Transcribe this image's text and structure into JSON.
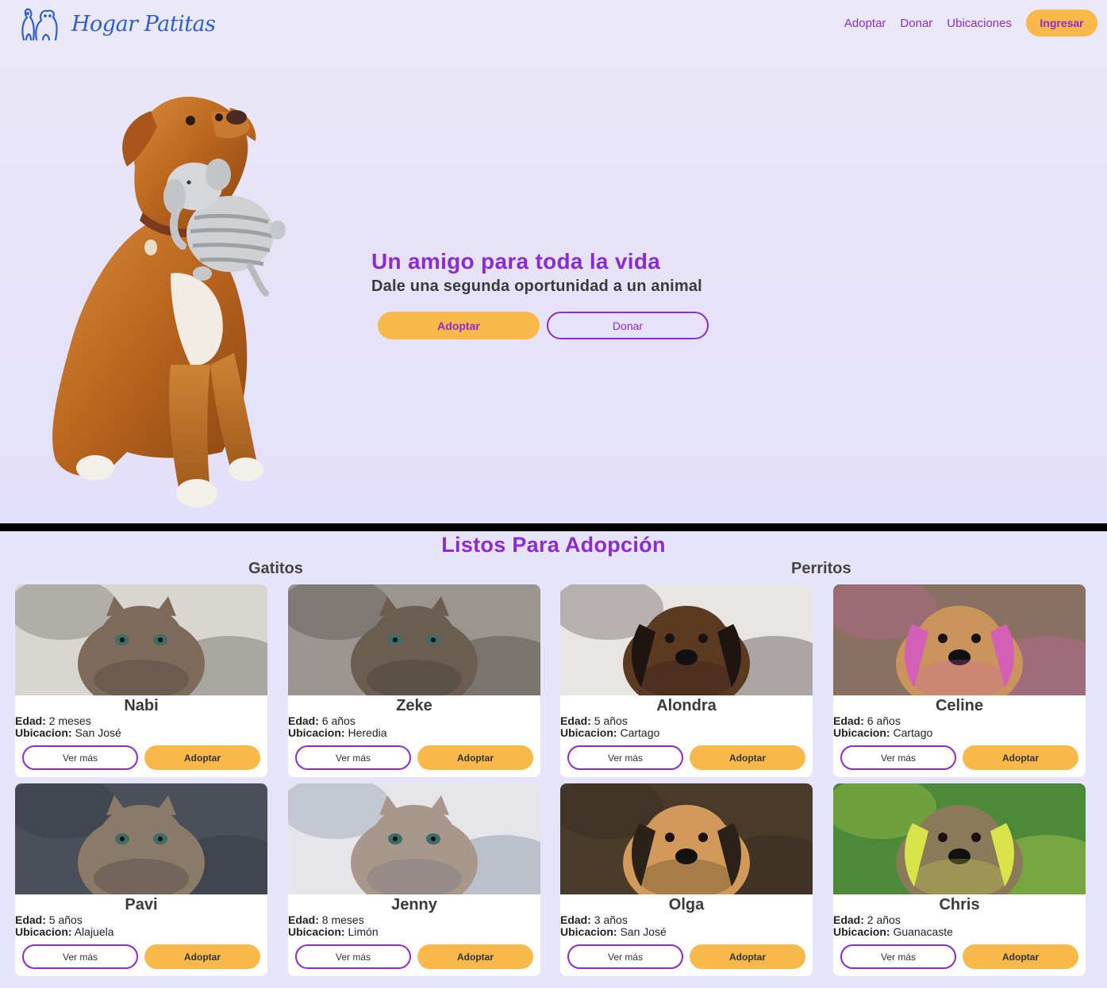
{
  "header": {
    "brand": "Hogar Patitas",
    "nav": [
      "Adoptar",
      "Donar",
      "Ubicaciones"
    ],
    "login_label": "Ingresar"
  },
  "hero": {
    "title": "Un amigo para toda la vida",
    "subtitle": "Dale una segunda oportunidad a un animal",
    "primary_label": "Adoptar",
    "secondary_label": "Donar"
  },
  "adoption": {
    "title": "Listos Para Adopción",
    "groups": [
      "Gatitos",
      "Perritos"
    ],
    "labels": {
      "age": "Edad:",
      "location": "Ubicacion:"
    },
    "buttons": {
      "more": "Ver más",
      "adopt": "Adoptar"
    },
    "animals": [
      {
        "name": "Nabi",
        "age": "2 meses",
        "location": "San José",
        "kind": "cat",
        "photo_colors": [
          "#d9d6d2",
          "#7d6a58",
          "#3d3530"
        ]
      },
      {
        "name": "Zeke",
        "age": "6 años",
        "location": "Heredia",
        "kind": "cat",
        "photo_colors": [
          "#9a958f",
          "#6b5e50",
          "#2f2a26"
        ]
      },
      {
        "name": "Alondra",
        "age": "5 años",
        "location": "Cartago",
        "kind": "dog",
        "photo_colors": [
          "#e8e6e3",
          "#5c3a22",
          "#1e1511"
        ]
      },
      {
        "name": "Celine",
        "age": "6 años",
        "location": "Cartago",
        "kind": "dog",
        "photo_colors": [
          "#8a7060",
          "#c9955a",
          "#d45fb7"
        ]
      },
      {
        "name": "Pavi",
        "age": "5 años",
        "location": "Alajuela",
        "kind": "cat",
        "photo_colors": [
          "#4a4f5a",
          "#8a7a68",
          "#2b2b30"
        ]
      },
      {
        "name": "Jenny",
        "age": "8 meses",
        "location": "Limón",
        "kind": "cat",
        "photo_colors": [
          "#e6e6ea",
          "#a8978a",
          "#5d6a80"
        ]
      },
      {
        "name": "Olga",
        "age": "3 años",
        "location": "San José",
        "kind": "dog",
        "photo_colors": [
          "#4a3a2a",
          "#d29a5a",
          "#2a2218"
        ]
      },
      {
        "name": "Chris",
        "age": "2 años",
        "location": "Guanacaste",
        "kind": "dog",
        "photo_colors": [
          "#4c8a3a",
          "#8a7a5a",
          "#d9e34a"
        ]
      }
    ]
  },
  "colors": {
    "accent": "#8a2bd6",
    "button_yellow": "#f9b94a",
    "brand_blue": "#2b5fd1"
  }
}
